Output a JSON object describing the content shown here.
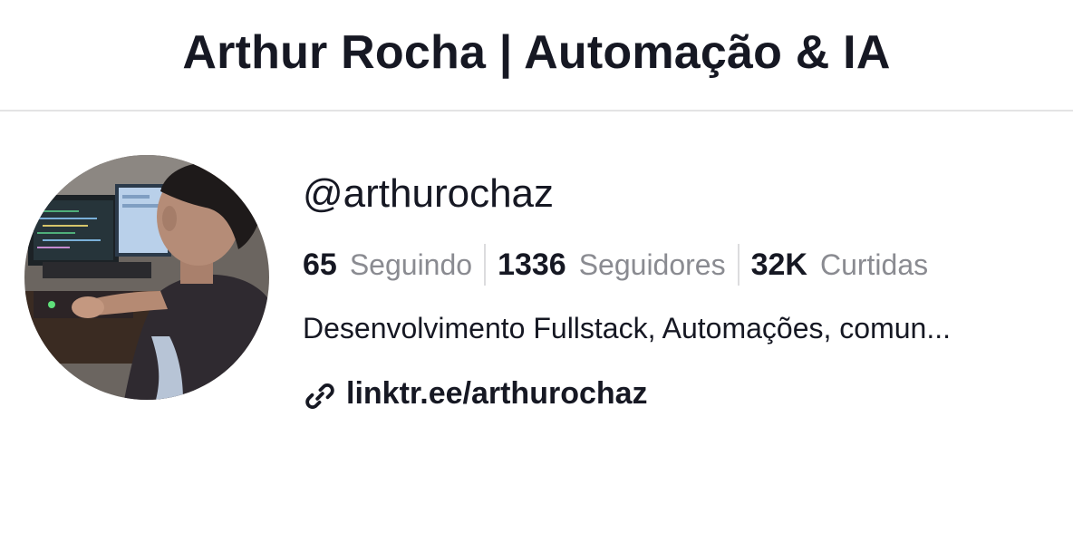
{
  "header": {
    "title": "Arthur Rocha | Automação & IA"
  },
  "profile": {
    "username": "@arthurochaz",
    "stats": {
      "following_count": "65",
      "following_label": "Seguindo",
      "followers_count": "1336",
      "followers_label": "Seguidores",
      "likes_count": "32K",
      "likes_label": "Curtidas"
    },
    "bio": "Desenvolvimento Fullstack, Automações, comun...",
    "link": {
      "text": "linktr.ee/arthurochaz",
      "icon": "link-icon"
    },
    "avatar_icon": "profile-photo"
  }
}
